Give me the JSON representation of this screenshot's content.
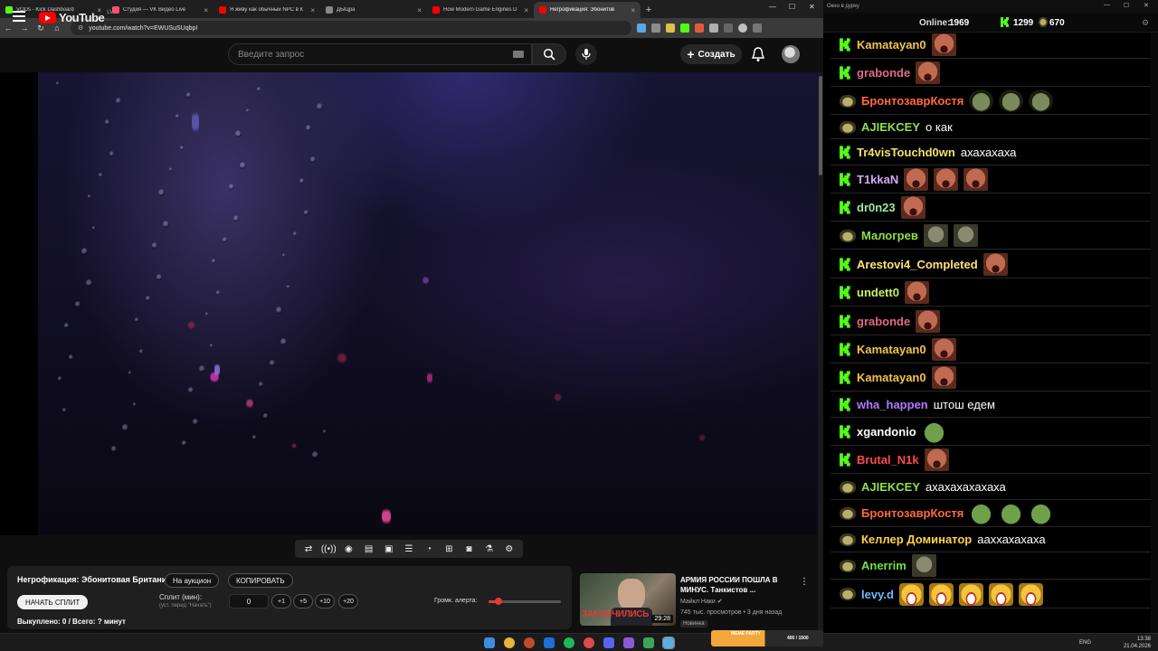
{
  "browser": {
    "tabs": [
      {
        "label": "VODs - Kick Dashboard",
        "color": "#53fc18",
        "active": false
      },
      {
        "label": "Студия — VK Видео Live",
        "color": "#ff4d6d",
        "active": false
      },
      {
        "label": "Я живу как обычный NPC в К",
        "color": "#ff0000",
        "active": false
      },
      {
        "label": "ДЫЦра",
        "color": "#888888",
        "active": false
      },
      {
        "label": "How Modern Game Engines D",
        "color": "#ff0000",
        "active": false
      },
      {
        "label": "Негрофикация: Эбонитов",
        "color": "#ff0000",
        "active": true
      }
    ],
    "url": "youtube.com/watch?v=EWUSuSUqbpI"
  },
  "youtube": {
    "logo_text": "YouTube",
    "region": "LV",
    "search_placeholder": "Введите запрос",
    "create_label": "Создать"
  },
  "panel": {
    "title": "Негрофикация: Эбонитовая Британия.",
    "auction_btn": "На аукцион",
    "copy_btn": "КОПИРОВАТЬ",
    "start_split_btn": "НАЧАТЬ СПЛИТ",
    "split_label": "Сплит (мин):",
    "split_hint": "(уст. перед \"Начать\")",
    "split_value": "0",
    "increments": [
      "+1",
      "+5",
      "+10",
      "+20"
    ],
    "volume_label": "Громк. алерта:",
    "volume_level": 0.14,
    "bought_text": "Выкуплено: 0 / Всего: ? минут"
  },
  "recommendation": {
    "title": "АРМИЯ РОССИИ ПОШЛА В МИНУС. Танкистов ...",
    "channel": "Майкл Наки",
    "meta": "745 тыс. просмотров • 3 дня назад",
    "badge": "Новинка",
    "duration": "29:28",
    "thumb_text": "ЗАКОНЧИЛИСЬ"
  },
  "chat": {
    "window_title": "Окно в дурку",
    "online_label": "Online:",
    "online_count": "1969",
    "kick_count": "1299",
    "vk_count": "670",
    "messages": [
      {
        "platform": "kick",
        "nick": "Kamatayan0",
        "color": "#f2c44a",
        "text": "",
        "emotes": [
          "face"
        ]
      },
      {
        "platform": "kick",
        "nick": "grabonde",
        "color": "#e06a8a",
        "text": "",
        "emotes": [
          "face"
        ]
      },
      {
        "platform": "vk",
        "nick": "БронтозаврКостя",
        "color": "#ff6a3d",
        "text": "",
        "emotes": [
          "frog",
          "frog",
          "frog"
        ]
      },
      {
        "platform": "vk",
        "nick": "AJIEKCEY",
        "color": "#8ee04a",
        "text": "о как",
        "emotes": []
      },
      {
        "platform": "kick",
        "nick": "Tr4visTouchd0wn",
        "color": "#f2e06a",
        "text": "ахахахаха",
        "emotes": []
      },
      {
        "platform": "kick",
        "nick": "T1kkaN",
        "color": "#d6a6ff",
        "text": "",
        "emotes": [
          "face",
          "face",
          "face"
        ]
      },
      {
        "platform": "kick",
        "nick": "dr0n23",
        "color": "#9ee6a6",
        "text": "",
        "emotes": [
          "face"
        ]
      },
      {
        "platform": "vk",
        "nick": "Малогрев",
        "color": "#8ee04a",
        "text": "",
        "emotes": [
          "gray",
          "gray"
        ]
      },
      {
        "platform": "kick",
        "nick": "Arestovi4_Completed",
        "color": "#ffe27a",
        "text": "",
        "emotes": [
          "face"
        ]
      },
      {
        "platform": "kick",
        "nick": "undett0",
        "color": "#c8f06a",
        "text": "",
        "emotes": [
          "face"
        ]
      },
      {
        "platform": "kick",
        "nick": "grabonde",
        "color": "#e06a8a",
        "text": "",
        "emotes": [
          "face"
        ]
      },
      {
        "platform": "kick",
        "nick": "Kamatayan0",
        "color": "#f2c44a",
        "text": "",
        "emotes": [
          "face"
        ]
      },
      {
        "platform": "kick",
        "nick": "Kamatayan0",
        "color": "#f2c44a",
        "text": "",
        "emotes": [
          "face"
        ]
      },
      {
        "platform": "kick",
        "nick": "wha_happen",
        "color": "#b07aff",
        "text": "штош едем",
        "emotes": []
      },
      {
        "platform": "kick",
        "nick": "xgandonio",
        "color": "#ffffff",
        "text": "",
        "emotes": [
          "pepe"
        ]
      },
      {
        "platform": "kick",
        "nick": "Brutal_N1k",
        "color": "#ff4a4a",
        "text": "",
        "emotes": [
          "face"
        ]
      },
      {
        "platform": "vk",
        "nick": "AJIEKCEY",
        "color": "#8ee04a",
        "text": "ахахахахахаха",
        "emotes": []
      },
      {
        "platform": "vk",
        "nick": "БронтозаврКостя",
        "color": "#ff6a3d",
        "text": "",
        "emotes": [
          "pepe",
          "pepe",
          "pepe"
        ]
      },
      {
        "platform": "vk",
        "nick": "Келлер Доминатор",
        "color": "#ffd24a",
        "text": "ааххахахаха",
        "emotes": []
      },
      {
        "platform": "vk",
        "nick": "Anerrim",
        "color": "#6ee04a",
        "text": "",
        "emotes": [
          "gray"
        ]
      },
      {
        "platform": "vk",
        "nick": "levy.d",
        "color": "#6ab8ff",
        "text": "",
        "emotes": [
          "laugh",
          "laugh",
          "laugh",
          "laugh",
          "laugh"
        ]
      }
    ]
  },
  "taskbar": {
    "lang": "ENG",
    "time": "13:38",
    "date": "21.04.2026",
    "widget_title": "MEME PARTY",
    "widget_progress": "400 / 1500"
  }
}
